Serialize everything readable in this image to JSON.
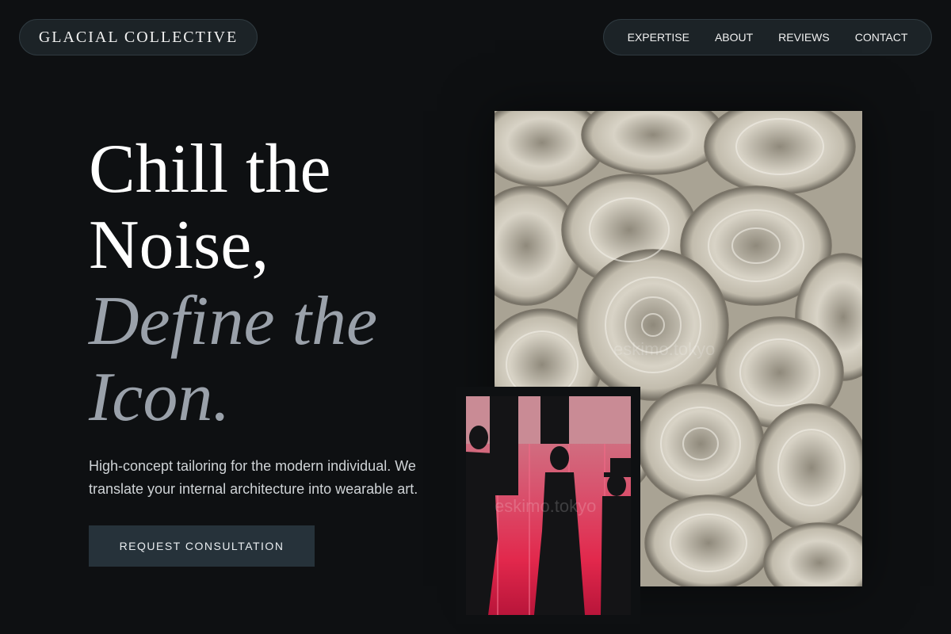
{
  "header": {
    "brand": "GLACIAL COLLECTIVE",
    "nav": [
      {
        "label": "EXPERTISE"
      },
      {
        "label": "ABOUT"
      },
      {
        "label": "REVIEWS"
      },
      {
        "label": "CONTACT"
      }
    ]
  },
  "hero": {
    "headline_line1": "Chill the",
    "headline_line2": "Noise,",
    "headline_line3": "Define the",
    "headline_line4": "Icon.",
    "tagline": "High-concept tailoring for the modern individual. We translate your internal architecture into wearable art.",
    "cta_label": "REQUEST CONSULTATION"
  },
  "images": {
    "fabric_watermark": "eskimo.tokyo",
    "mannequin_watermark": "eskimo.tokyo"
  },
  "colors": {
    "background": "#0e1012",
    "pill_background": "#1c2327",
    "accent_text": "#9aa1aa",
    "cta_background": "#26323a",
    "mannequin_backdrop": "#e2284c"
  }
}
